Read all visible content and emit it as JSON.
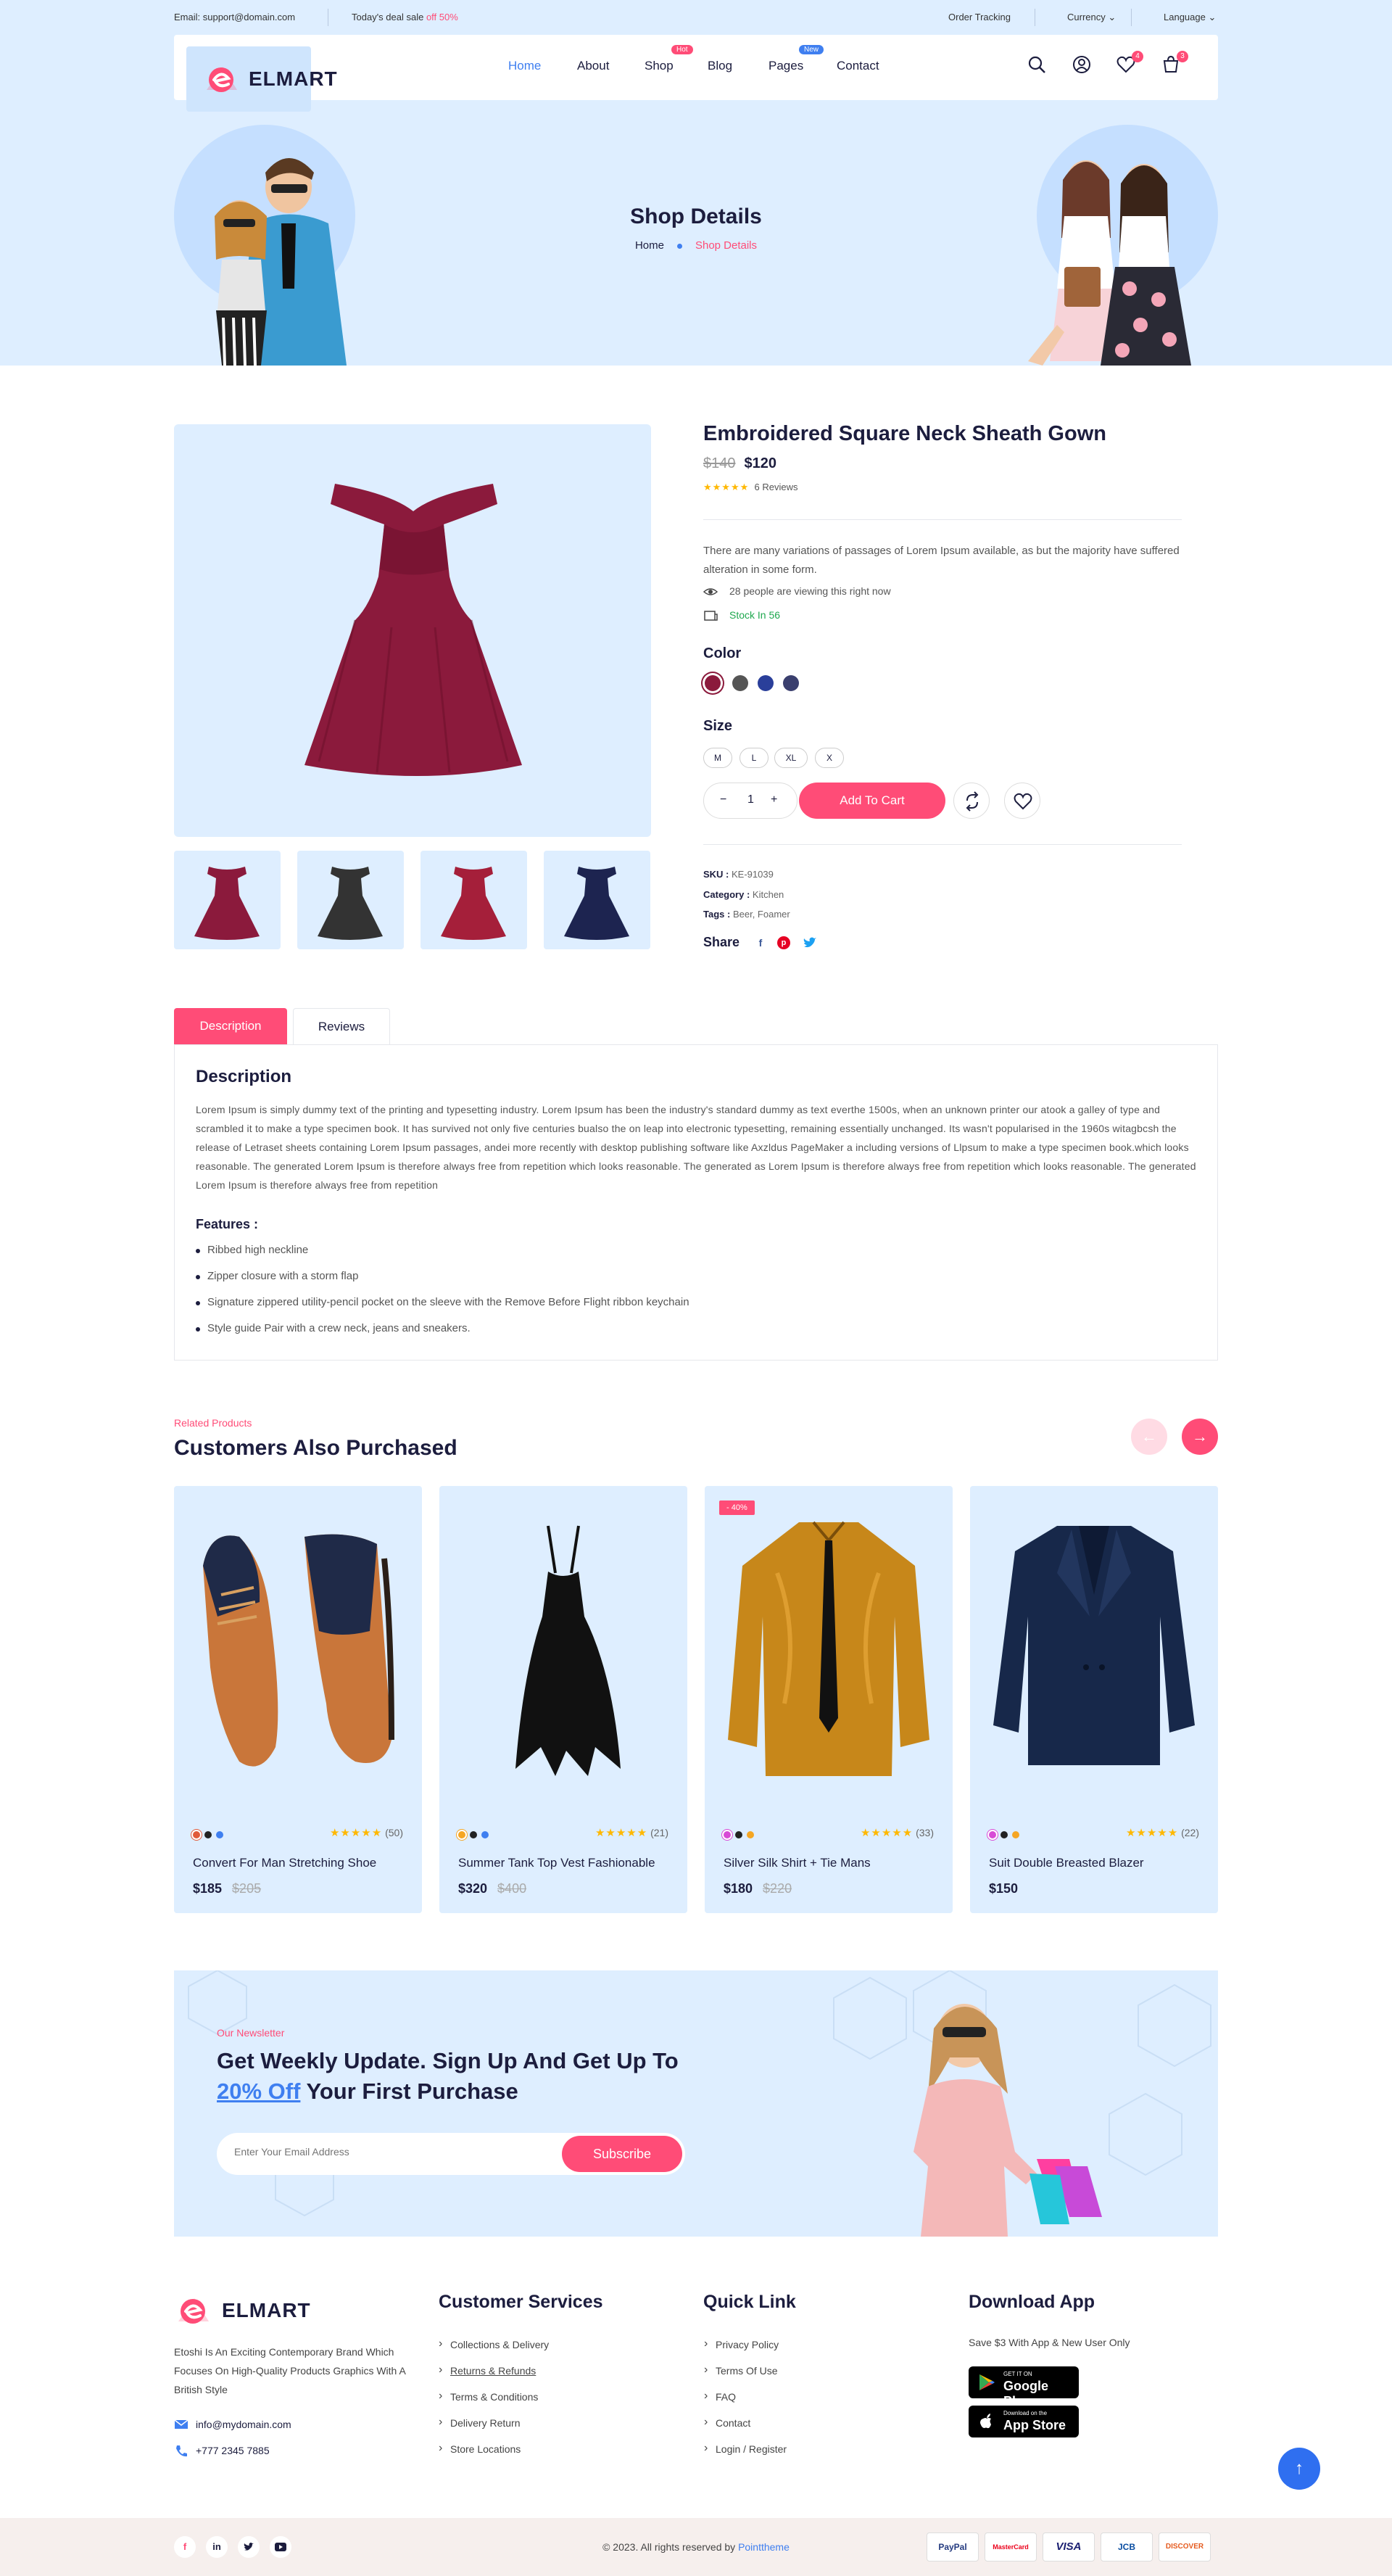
{
  "topbar": {
    "email": "Email: support@domain.com",
    "deal_prefix": "Today's deal sale",
    "deal_highlight": "off 50%",
    "order_tracking": "Order Tracking",
    "currency": "Currency ⌄",
    "language": "Language ⌄"
  },
  "brand": {
    "name": "ELMART"
  },
  "nav": {
    "items": [
      "Home",
      "About",
      "Shop",
      "Blog",
      "Pages",
      "Contact"
    ],
    "shop_badge": "Hot",
    "pages_badge": "New",
    "wishlist_count": "4",
    "cart_count": "3"
  },
  "hero": {
    "title": "Shop Details",
    "crumb_home": "Home",
    "crumb_current": "Shop Details"
  },
  "product": {
    "title": "Embroidered Square Neck Sheath Gown",
    "old_price": "$140",
    "price": "$120",
    "stars": "★★★★★",
    "reviews": "6 Reviews",
    "description": "There are many variations of passages of Lorem Ipsum available, as but the majority have suffered alteration in some form.",
    "viewing": "28 people are viewing this right now",
    "stock": "Stock In 56",
    "color_label": "Color",
    "colors": [
      "#8b1a3c",
      "#555555",
      "#2a3f9a",
      "#3a3f6e"
    ],
    "size_label": "Size",
    "sizes": [
      "M",
      "L",
      "XL",
      "X"
    ],
    "qty": "1",
    "qty_minus": "−",
    "qty_plus": "+",
    "add_to_cart": "Add To Cart",
    "sku_label": "SKU :",
    "sku": "KE-91039",
    "category_label": "Category :",
    "category": "Kitchen",
    "tags_label": "Tags :",
    "tags": "Beer, Foamer",
    "share_label": "Share"
  },
  "tabs": {
    "description": "Description",
    "reviews": "Reviews"
  },
  "details": {
    "heading": "Description",
    "text": "Lorem Ipsum is simply dummy text of the printing and typesetting industry. Lorem Ipsum has been the industry's standard dummy as text everthe 1500s, when an unknown printer our atook a galley of type and scrambled it to make a type specimen book. It has survived not only five centuries bualso the on leap into electronic typesetting, remaining essentially unchanged. Its wasn't popularised in the 1960s witagbcsh the release of Letraset sheets containing Lorem Ipsum passages, andei more recently with desktop publishing software like Axzldus PageMaker a including versions of Llpsum to make a type specimen book.which looks reasonable. The generated Lorem Ipsum is therefore always free from repetition which looks reasonable. The generated as Lorem Ipsum is therefore always free from repetition which looks reasonable. The generated Lorem Ipsum is therefore always free from repetition",
    "features_heading": "Features :",
    "features": [
      "Ribbed high neckline",
      "Zipper closure with a storm flap",
      "Signature zippered utility-pencil pocket on the sleeve with the Remove Before Flight ribbon keychain",
      "Style guide Pair with a crew neck, jeans and sneakers."
    ]
  },
  "related": {
    "subtitle": "Related Products",
    "title": "Customers Also Purchased",
    "prev": "←",
    "next": "→",
    "products": [
      {
        "name": "Convert For Man Stretching Shoe",
        "price": "$185",
        "old_price": "$205",
        "stars": "★★★★★",
        "count": "(50)",
        "colors": [
          "#e05a3a",
          "#222222",
          "#3f7ff0"
        ]
      },
      {
        "name": "Summer Tank Top Vest Fashionable",
        "price": "$320",
        "old_price": "$400",
        "stars": "★★★★★",
        "count": "(21)",
        "colors": [
          "#f5a623",
          "#222222",
          "#3f7ff0"
        ]
      },
      {
        "name": "Silver Silk Shirt + Tie Mans",
        "price": "$180",
        "old_price": "$220",
        "stars": "★★★★★",
        "count": "(33)",
        "colors": [
          "#d84ad6",
          "#222222",
          "#f5a623"
        ],
        "badge": "- 40%"
      },
      {
        "name": "Suit Double Breasted Blazer",
        "price": "$150",
        "old_price": "",
        "stars": "★★★★★",
        "count": "(22)",
        "colors": [
          "#d84ad6",
          "#222222",
          "#f5a623"
        ]
      }
    ]
  },
  "newsletter": {
    "subtitle": "Our Newsletter",
    "line1": "Get Weekly Update. Sign Up And Get Up To",
    "highlight": "20% Off",
    "line2": "Your First Purchase",
    "placeholder": "Enter Your Email Address",
    "button": "Subscribe"
  },
  "footer": {
    "description": "Etoshi Is An Exciting Contemporary Brand Which Focuses On High-Quality Products Graphics With A British Style",
    "email": "info@mydomain.com",
    "phone": "+777 2345 7885",
    "services_title": "Customer Services",
    "services": [
      "Collections & Delivery",
      "Returns & Refunds",
      "Terms & Conditions",
      "Delivery Return",
      "Store Locations"
    ],
    "quick_title": "Quick Link",
    "quick": [
      "Privacy Policy",
      "Terms Of Use",
      "FAQ",
      "Contact",
      "Login / Register"
    ],
    "app_title": "Download App",
    "app_text": "Save $3 With App & New User Only",
    "google_small": "GET IT ON",
    "google_big": "Google Play",
    "apple_small": "Download on the",
    "apple_big": "App Store",
    "copyright_prefix": "© 2023. All rights reserved by",
    "copyright_brand": "Pointtheme",
    "payments": [
      "PayPal",
      "MasterCard",
      "VISA",
      "JCB",
      "DISCOVER"
    ]
  },
  "colors": {
    "accent": "#ff4c77",
    "blue": "#3f7ff0",
    "light_bg": "#deeeff",
    "dark": "#1c1d3e"
  }
}
